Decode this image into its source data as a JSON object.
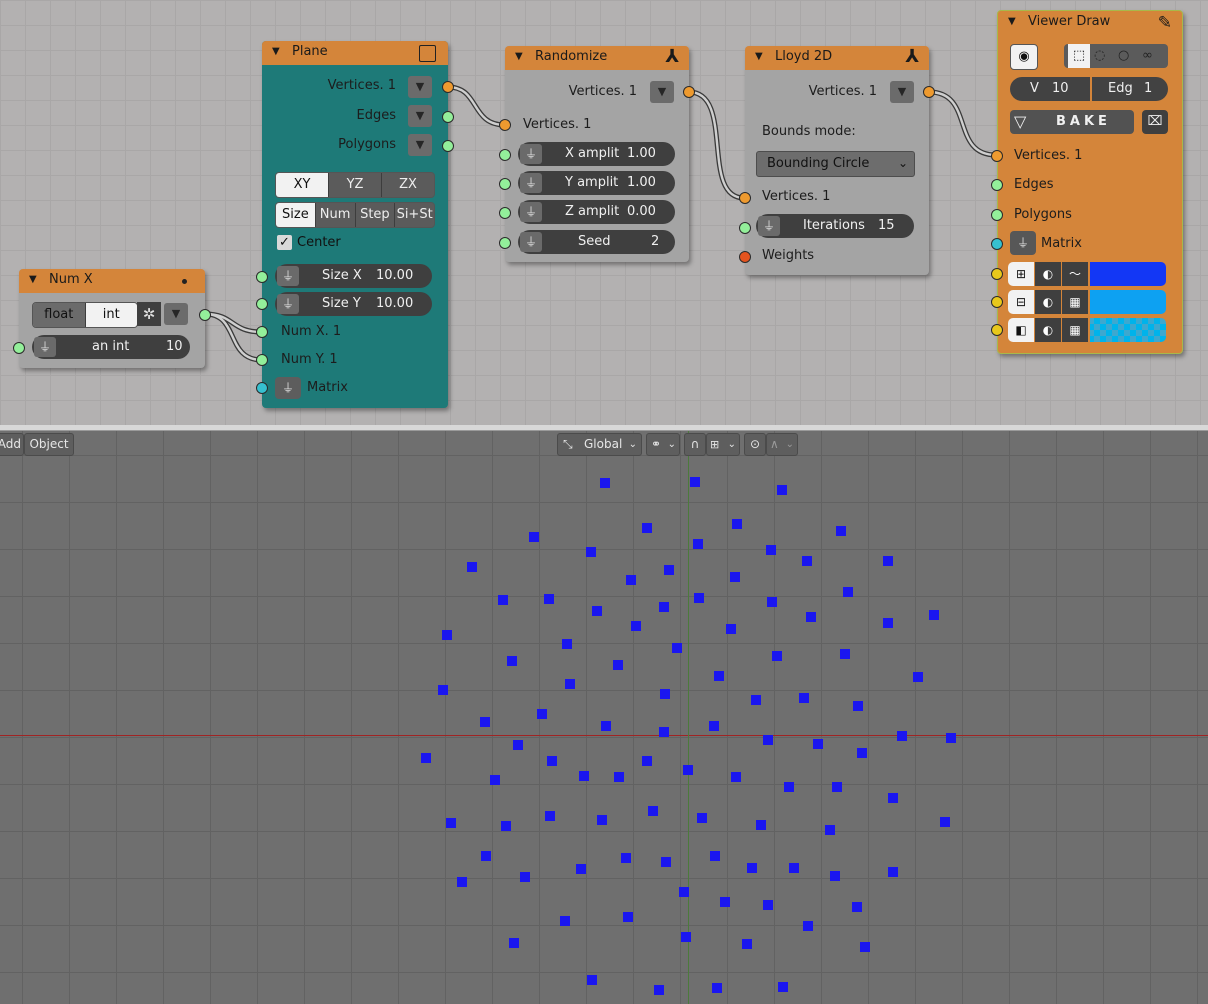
{
  "nodes": {
    "plane": {
      "title": "Plane",
      "outputs": [
        "Vertices. 1",
        "Edges",
        "Polygons"
      ],
      "axis_options": [
        "XY",
        "YZ",
        "ZX"
      ],
      "axis_selected": "XY",
      "mode_options": [
        "Size",
        "Num",
        "Step",
        "Si+St"
      ],
      "mode_selected": "Size",
      "center_label": "Center",
      "center_checked": true,
      "size_x_label": "Size X",
      "size_x_value": "10.00",
      "size_y_label": "Size Y",
      "size_y_value": "10.00",
      "inputs": [
        "Num X. 1",
        "Num Y. 1",
        "Matrix"
      ]
    },
    "num_x": {
      "title": "Num X",
      "type_options": [
        "float",
        "int"
      ],
      "type_selected": "int",
      "field_label": "an int",
      "field_value": "10"
    },
    "randomize": {
      "title": "Randomize",
      "output": "Vertices. 1",
      "input": "Vertices. 1",
      "fields": [
        {
          "label": "X amplit",
          "value": "1.00"
        },
        {
          "label": "Y amplit",
          "value": "1.00"
        },
        {
          "label": "Z amplit",
          "value": "0.00"
        },
        {
          "label": "Seed",
          "value": "2"
        }
      ]
    },
    "lloyd": {
      "title": "Lloyd 2D",
      "output": "Vertices. 1",
      "bounds_label": "Bounds mode:",
      "bounds_value": "Bounding Circle",
      "input_vertices": "Vertices. 1",
      "iterations_label": "Iterations",
      "iterations_value": "15",
      "weights_label": "Weights"
    },
    "viewer": {
      "title": "Viewer Draw",
      "v_label": "V",
      "v_value": "10",
      "edg_label": "Edg",
      "edg_value": "1",
      "bake_label": "BAKE",
      "inputs": [
        "Vertices. 1",
        "Edges",
        "Polygons",
        "Matrix"
      ],
      "colors": [
        "#1337f5",
        "#0da1f2",
        "#00b3eb"
      ]
    }
  },
  "viewport": {
    "left_buttons": [
      "Add",
      "Object"
    ],
    "orientation": "Global",
    "axis_x_color": "#a02424",
    "axis_y_color": "#4c7a3c",
    "point_color": "#1a16f0"
  }
}
